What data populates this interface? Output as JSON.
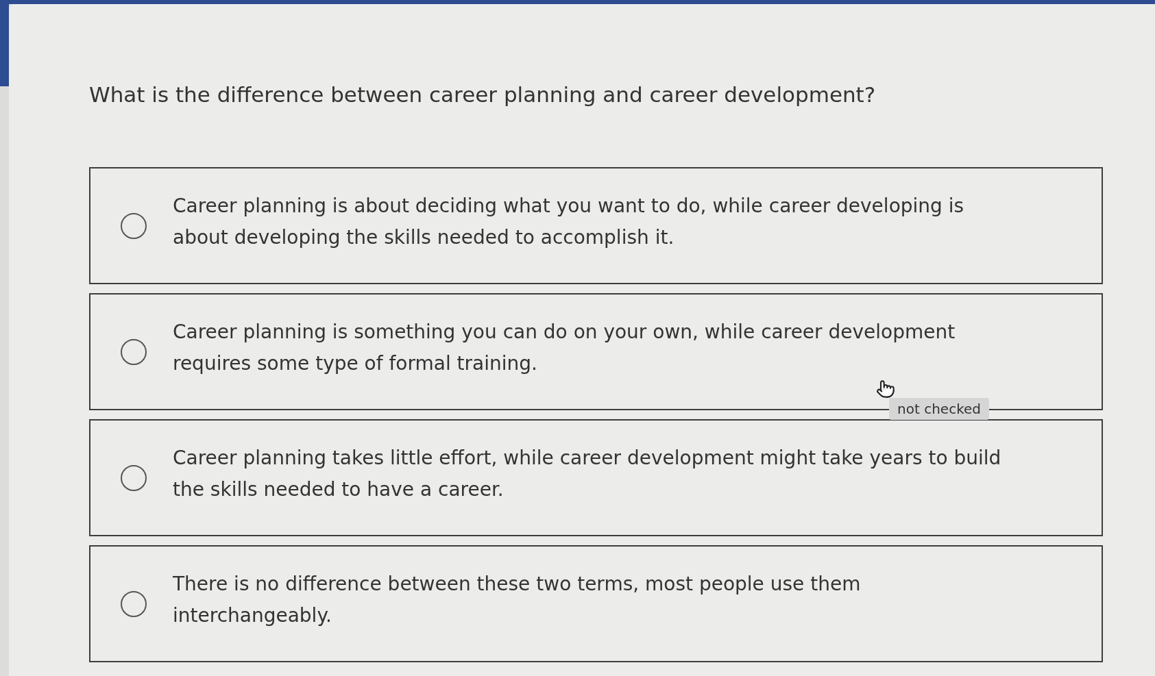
{
  "question": "What is the difference between career planning and career development?",
  "options": [
    {
      "text": "Career planning is about deciding what you want to do, while career developing is about developing the skills needed to accomplish it.",
      "selected": false
    },
    {
      "text": "Career planning is something you can do on your own, while career development requires some type of formal training.",
      "selected": false,
      "tooltip": "not checked"
    },
    {
      "text": "Career planning takes little effort, while career development might take years to build the skills needed to have a career.",
      "selected": false
    },
    {
      "text": "There is no difference between these two terms, most people use them interchangeably.",
      "selected": false
    }
  ]
}
